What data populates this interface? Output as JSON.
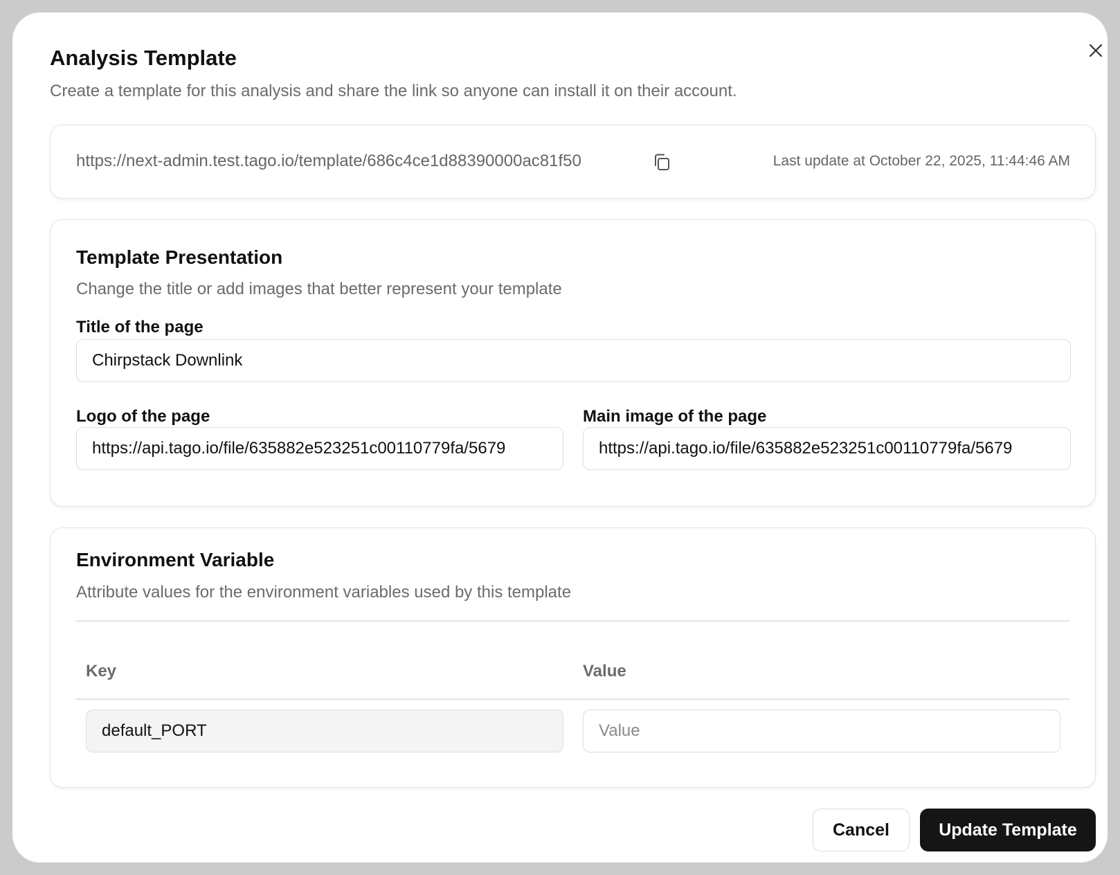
{
  "dialog": {
    "title": "Analysis Template",
    "subtitle": "Create a template for this analysis and share the link so anyone can install it on their account."
  },
  "share_link": {
    "url": "https://next-admin.test.tago.io/template/686c4ce1d88390000ac81f50",
    "last_update": "Last update at October 22, 2025, 11:44:46 AM",
    "copy_icon": "copy-icon"
  },
  "presentation": {
    "title": "Template Presentation",
    "description": "Change the title or add images that better represent your template",
    "page_title_label": "Title of the page",
    "page_title_value": "Chirpstack Downlink",
    "logo_label": "Logo of the page",
    "logo_value": "https://api.tago.io/file/635882e523251c00110779fa/5679",
    "main_image_label": "Main image of the page",
    "main_image_value": "https://api.tago.io/file/635882e523251c00110779fa/5679"
  },
  "environment": {
    "title": "Environment Variable",
    "description": "Attribute values for the environment variables used by this template",
    "columns": {
      "key": "Key",
      "value": "Value"
    },
    "rows": [
      {
        "key": "default_PORT",
        "value": "",
        "value_placeholder": "Value"
      }
    ]
  },
  "footer": {
    "cancel_label": "Cancel",
    "submit_label": "Update Template"
  },
  "colors": {
    "primary_button": "#151515",
    "backdrop": "#cbcbcb",
    "muted_text": "#6b6b6b"
  }
}
